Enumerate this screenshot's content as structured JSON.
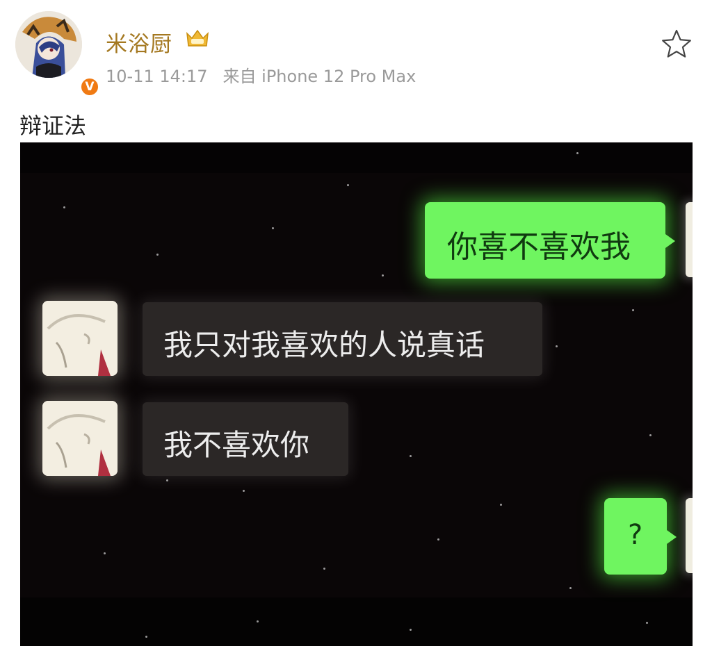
{
  "post": {
    "username": "米浴厨",
    "timestamp": "10-11 14:17",
    "source": "来自 iPhone 12 Pro Max",
    "text": "辩证法",
    "icons": {
      "avatar": "user-avatar-icon",
      "verified": "verified-badge-icon",
      "vip": "vip-crown-icon",
      "favorite": "star-icon"
    },
    "verified_label": "V"
  },
  "chat_image": {
    "messages": [
      {
        "side": "right",
        "text": "你喜不喜欢我"
      },
      {
        "side": "left",
        "text": "我只对我喜欢的人说真话"
      },
      {
        "side": "left",
        "text": "我不喜欢你"
      },
      {
        "side": "right",
        "text": "?"
      }
    ],
    "colors": {
      "background": "#0a0607",
      "right_bubble": "#6ff560",
      "left_bubble": "#2b2726",
      "username": "#a47820",
      "verified": "#f07a13"
    }
  }
}
